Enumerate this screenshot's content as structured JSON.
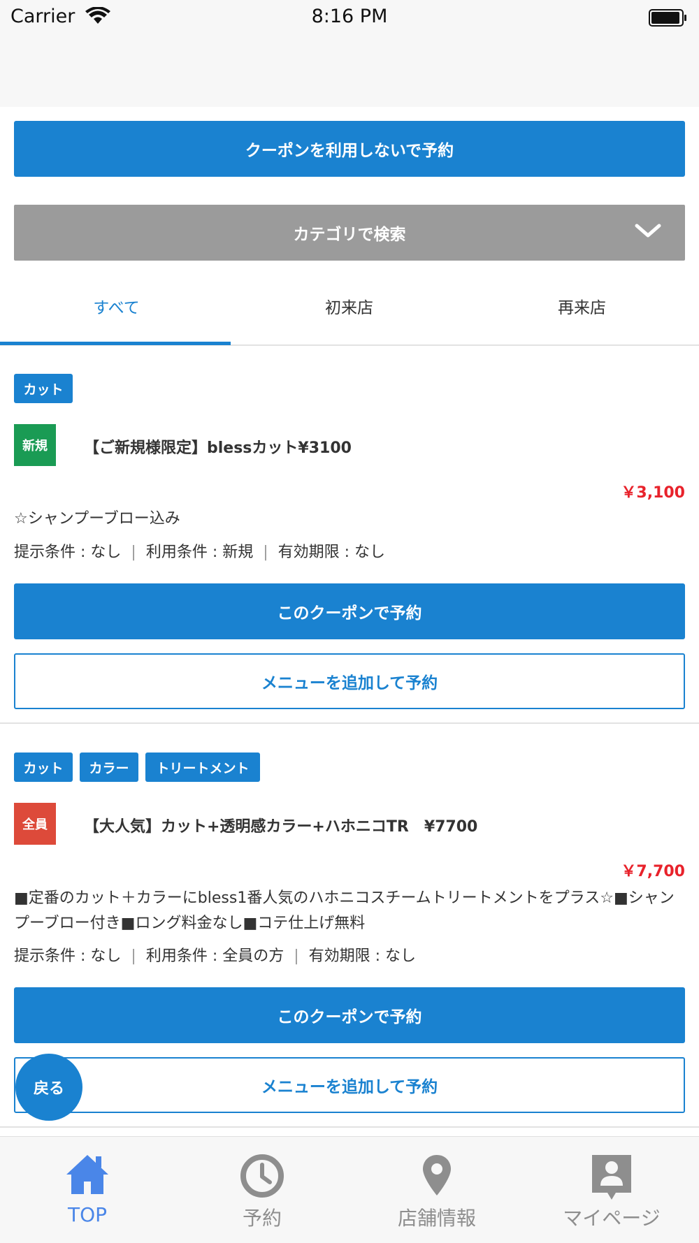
{
  "status_bar": {
    "carrier": "Carrier",
    "time": "8:16 PM"
  },
  "no_coupon_button": "クーポンを利用しないで予約",
  "category_search": "カテゴリで検索",
  "tabs": [
    {
      "label": "すべて",
      "active": true
    },
    {
      "label": "初来店",
      "active": false
    },
    {
      "label": "再来店",
      "active": false
    }
  ],
  "coupons": [
    {
      "tags": [
        "カット"
      ],
      "badge": "新規",
      "badge_color": "#1a9b54",
      "title": "【ご新規様限定】blessカット¥3100",
      "price": "￥3,100",
      "description": "☆シャンプーブロー込み",
      "conditions": [
        "提示条件 : なし",
        "利用条件 : 新規",
        "有効期限 : なし"
      ],
      "book_label": "このクーポンで予約",
      "add_menu_label": "メニューを追加して予約"
    },
    {
      "tags": [
        "カット",
        "カラー",
        "トリートメント"
      ],
      "badge": "全員",
      "badge_color": "#dd4a3a",
      "title": "【大人気】カット+透明感カラー+ハホニコTR　¥7700",
      "price": "￥7,700",
      "description": "■定番のカット＋カラーにbless1番人気のハホニコスチームトリートメントをプラス☆■シャンプーブロー付き■ロング料金なし■コテ仕上げ無料",
      "conditions": [
        "提示条件 : なし",
        "利用条件 : 全員の方",
        "有効期限 : なし"
      ],
      "book_label": "このクーポンで予約",
      "add_menu_label": "メニューを追加して予約"
    }
  ],
  "back_button": "戻る",
  "tab_bar": [
    {
      "label": "TOP",
      "icon": "home-icon",
      "active": true
    },
    {
      "label": "予約",
      "icon": "clock-icon",
      "active": false
    },
    {
      "label": "店舗情報",
      "icon": "map-pin-icon",
      "active": false
    },
    {
      "label": "マイページ",
      "icon": "user-card-icon",
      "active": false
    }
  ],
  "colors": {
    "primary": "#1a82d0",
    "price": "#e8222b",
    "tab_active": "#4a86e8",
    "inactive": "#8e8e8e"
  }
}
